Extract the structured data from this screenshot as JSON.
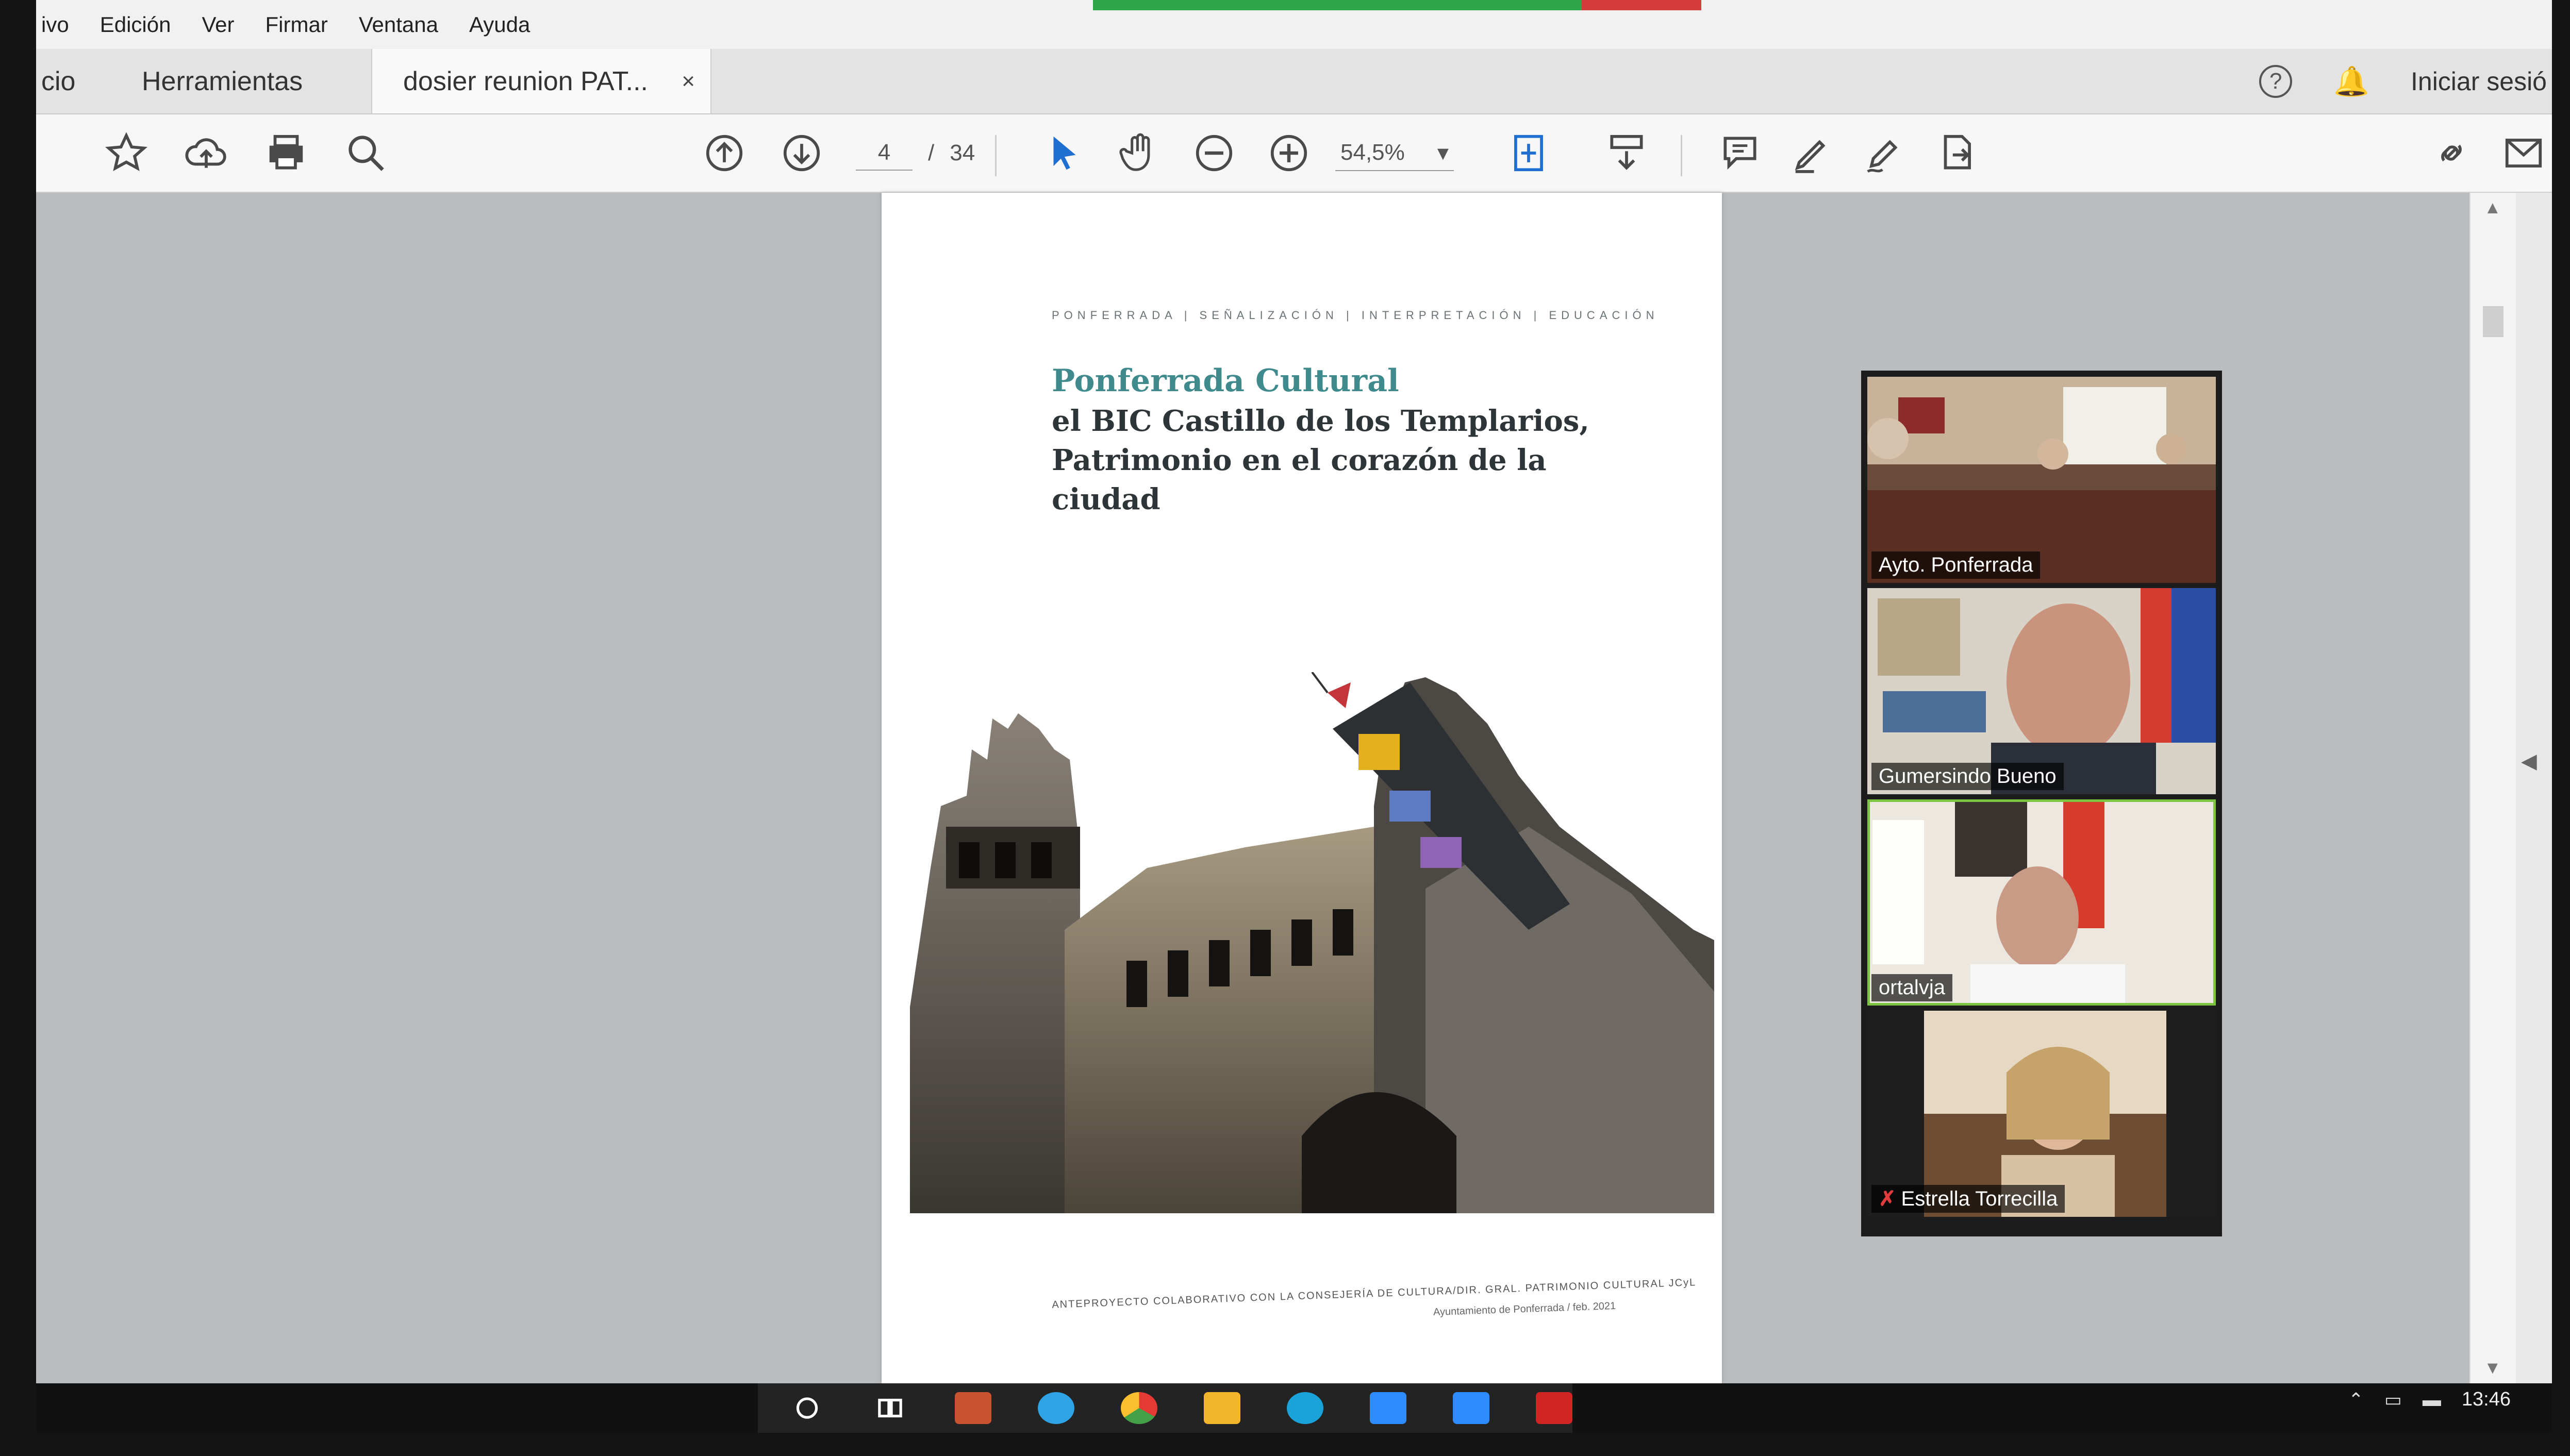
{
  "menu": {
    "items": [
      "ivo",
      "Edición",
      "Ver",
      "Firmar",
      "Ventana",
      "Ayuda"
    ]
  },
  "tabs": {
    "home": "cio",
    "tools": "Herramientas",
    "document": "dosier reunion PAT...",
    "close": "×",
    "help": "?",
    "signin": "Iniciar sesió"
  },
  "toolbar": {
    "page_current": "4",
    "page_separator": "/",
    "page_total": "34",
    "zoom": "54,5%",
    "icons": [
      "bookmark-star-icon",
      "upload-cloud-icon",
      "print-icon",
      "search-icon",
      "page-up-icon",
      "page-down-icon",
      "select-cursor-icon",
      "hand-icon",
      "zoom-out-icon",
      "zoom-in-icon",
      "fit-page-icon",
      "scroll-mode-icon",
      "comment-icon",
      "highlight-pen-icon",
      "sign-icon",
      "export-icon",
      "share-link-icon",
      "mail-icon"
    ]
  },
  "pdf_page": {
    "kicker": "PONFERRADA | SEÑALIZACIÓN | INTERPRETACIÓN | EDUCACIÓN",
    "title_line1": "Ponferrada Cultural",
    "title_rest": "el BIC Castillo de los Templarios, Patrimonio en el corazón de la ciudad",
    "footer_line1": "ANTEPROYECTO COLABORATIVO CON LA CONSEJERÍA DE CULTURA/DIR. GRAL. PATRIMONIO CULTURAL JCyL",
    "footer_line2": "Ayuntamiento de Ponferrada / feb. 2021"
  },
  "video_call": {
    "participants": [
      {
        "name": "Ayto. Ponferrada",
        "muted": false,
        "active": false
      },
      {
        "name": "Gumersindo Bueno",
        "muted": false,
        "active": false
      },
      {
        "name": "ortalvja",
        "muted": false,
        "active": true
      },
      {
        "name": "Estrella Torrecilla",
        "muted": true,
        "active": false
      }
    ]
  },
  "taskbar": {
    "time": "13:46"
  },
  "colors": {
    "menu_bg": "#f1f1f1",
    "tab_bg": "#e3e3e3",
    "doc_bg": "#b9bdc0",
    "title_accent": "#3f8a8d",
    "active_speaker": "#7dc443",
    "meeting_green": "#2fa64a",
    "meeting_red": "#d53c3c"
  }
}
